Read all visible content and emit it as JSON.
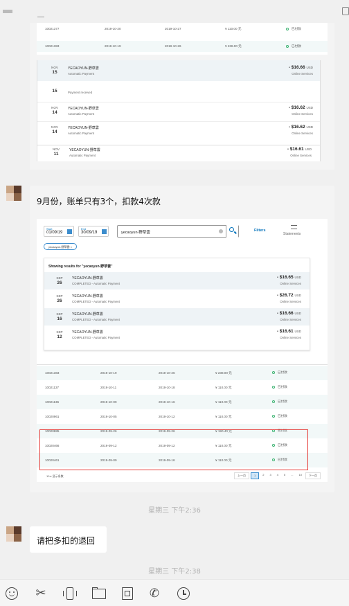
{
  "top_card": {
    "table_rows": [
      {
        "id": "10021377",
        "date1": "2019-10-20",
        "date2": "2019-10-27",
        "amount": "¥ 110.00 元",
        "status": "已付款"
      },
      {
        "id": "10021383",
        "date1": "2019-10-19",
        "date2": "2019-10-26",
        "amount": "¥ 238.00 元",
        "status": "已付款"
      }
    ],
    "transactions": [
      {
        "mon": "NOV",
        "day": "15",
        "merchant": "YECAOYUN-野草雲",
        "sub": "Automatic Payment",
        "amount": "- $16.66",
        "currency": "USD",
        "category": "Online Services"
      },
      {
        "mon": "",
        "day": "15",
        "merchant": "",
        "sub": "Payment received",
        "amount": "",
        "currency": "",
        "category": ""
      },
      {
        "mon": "NOV",
        "day": "14",
        "merchant": "YECAOYUN-野草雲",
        "sub": "Automatic Payment",
        "amount": "- $16.62",
        "currency": "USD",
        "category": "Online Services"
      },
      {
        "mon": "NOV",
        "day": "14",
        "merchant": "YECAOYUN-野草雲",
        "sub": "Automatic Payment",
        "amount": "- $16.62",
        "currency": "USD",
        "category": "Online Services"
      },
      {
        "mon": "NOV",
        "day": "11",
        "merchant": "YECAOYUN-野草雲",
        "sub": "Automatic Payment",
        "amount": "- $16.61",
        "currency": "USD",
        "category": "Online Services"
      }
    ]
  },
  "message_main": {
    "text": "9月份，账单只有3个，扣款4次款",
    "search": {
      "start_label": "Start",
      "start_value": "01/09/19",
      "end_label": "End",
      "end_value": "30/09/19",
      "query": "yecaoyun-野草雲",
      "filters": "Filters",
      "statements": "Statements",
      "chip": "yecaoyun-野草雲 ×"
    },
    "results_title": "Showing results for \"yecaoyun-野草雲\"",
    "results": [
      {
        "mon": "SEP",
        "day": "26",
        "merchant": "YECAOYUN-野草雲",
        "sub": "COMPLETED - Automatic Payment",
        "amount": "- $16.65",
        "currency": "USD",
        "category": "Online Services"
      },
      {
        "mon": "SEP",
        "day": "26",
        "merchant": "YECAOYUN-野草雲",
        "sub": "COMPLETED - Automatic Payment",
        "amount": "- $26.72",
        "currency": "USD",
        "category": "Online Services"
      },
      {
        "mon": "SEP",
        "day": "16",
        "merchant": "YECAOYUN-野草雲",
        "sub": "COMPLETED - Automatic Payment",
        "amount": "- $16.66",
        "currency": "USD",
        "category": "Online Services"
      },
      {
        "mon": "SEP",
        "day": "12",
        "merchant": "YECAOYUN-野草雲",
        "sub": "COMPLETED - Automatic Payment",
        "amount": "- $16.61",
        "currency": "USD",
        "category": "Online Services"
      }
    ],
    "bills": [
      {
        "id": "10021383",
        "date1": "2019-10-19",
        "date2": "2019-10-26",
        "amount": "¥ 238.00 元",
        "status": "已付款"
      },
      {
        "id": "10021137",
        "date1": "2019-10-11",
        "date2": "2019-10-18",
        "amount": "¥ 110.00 元",
        "status": "已付款"
      },
      {
        "id": "10021136",
        "date1": "2019-10-09",
        "date2": "2019-10-16",
        "amount": "¥ 110.00 元",
        "status": "已付款"
      },
      {
        "id": "10020961",
        "date1": "2019-10-05",
        "date2": "2019-10-12",
        "amount": "¥ 110.00 元",
        "status": "已付款"
      },
      {
        "id": "10020885",
        "date1": "2019-09-26",
        "date2": "2019-09-26",
        "amount": "¥ 190.40 元",
        "status": "已付款"
      },
      {
        "id": "10020466",
        "date1": "2019-09-12",
        "date2": "2019-09-12",
        "amount": "¥ 110.00 元",
        "status": "已付款"
      },
      {
        "id": "10020461",
        "date1": "2019-09-09",
        "date2": "2019-09-16",
        "amount": "¥ 110.00 元",
        "status": "已付款"
      }
    ],
    "pager": {
      "per_page": "10 ▾ 显示条数",
      "prev": "上一页",
      "pages": [
        "1",
        "2",
        "3",
        "4",
        "5",
        "...",
        "10"
      ],
      "next": "下一页"
    }
  },
  "timestamp1": "星期三  下午2:36",
  "message_second": {
    "text": "请把多扣的退回"
  },
  "timestamp2": "星期三  下午2:38",
  "toolbar": [
    "emoji-icon",
    "scissors-icon",
    "phone-shake-icon",
    "folder-icon",
    "document-icon",
    "phone-icon",
    "clock-icon"
  ],
  "colors": {
    "highlight": "#e53935",
    "link": "#0070ba",
    "status": "#3cb371"
  }
}
